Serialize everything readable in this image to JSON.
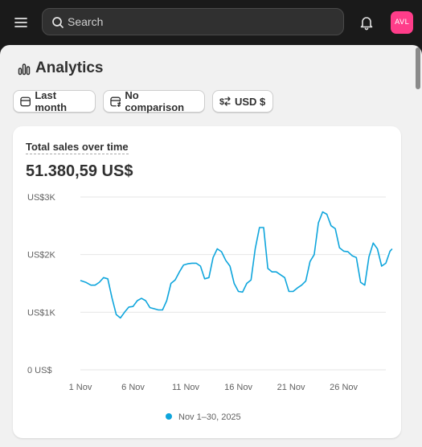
{
  "header": {
    "search_placeholder": "Search",
    "avatar_initials": "AVL",
    "avatar_color": "#ff3d8a"
  },
  "page": {
    "title": "Analytics"
  },
  "filters": {
    "date_range": "Last month",
    "comparison": "No comparison",
    "currency": "USD $"
  },
  "card": {
    "title": "Total sales over time",
    "total": "51.380,59 US$"
  },
  "chart_data": {
    "type": "line",
    "title": "Total sales over time",
    "y_tick_labels": [
      "0 US$",
      "US$1K",
      "US$2K",
      "US$3K"
    ],
    "y_ticks": [
      0,
      1000,
      2000,
      3000
    ],
    "ylim": [
      0,
      3000
    ],
    "x_tick_labels": [
      "1 Nov",
      "6 Nov",
      "11 Nov",
      "16 Nov",
      "21 Nov",
      "26 Nov"
    ],
    "x_tick_days": [
      1,
      6,
      11,
      16,
      21,
      26
    ],
    "xlim": [
      1,
      30
    ],
    "grid": true,
    "legend_position": "bottom",
    "series": [
      {
        "name": "Nov 1–30, 2025",
        "color": "#0ea5dc",
        "points": [
          [
            1,
            1550
          ],
          [
            1.5,
            1520
          ],
          [
            2,
            1470
          ],
          [
            2.4,
            1470
          ],
          [
            2.8,
            1520
          ],
          [
            3.2,
            1600
          ],
          [
            3.6,
            1580
          ],
          [
            4,
            1250
          ],
          [
            4.4,
            960
          ],
          [
            4.8,
            900
          ],
          [
            5.2,
            1000
          ],
          [
            5.6,
            1090
          ],
          [
            6,
            1100
          ],
          [
            6.4,
            1200
          ],
          [
            6.8,
            1240
          ],
          [
            7.2,
            1200
          ],
          [
            7.6,
            1080
          ],
          [
            8,
            1060
          ],
          [
            8.4,
            1040
          ],
          [
            8.8,
            1040
          ],
          [
            9.2,
            1200
          ],
          [
            9.6,
            1500
          ],
          [
            10,
            1560
          ],
          [
            10.4,
            1700
          ],
          [
            10.8,
            1820
          ],
          [
            11.2,
            1840
          ],
          [
            11.6,
            1850
          ],
          [
            12,
            1850
          ],
          [
            12.4,
            1800
          ],
          [
            12.8,
            1580
          ],
          [
            13.2,
            1600
          ],
          [
            13.6,
            1950
          ],
          [
            14,
            2100
          ],
          [
            14.4,
            2050
          ],
          [
            14.8,
            1900
          ],
          [
            15.2,
            1800
          ],
          [
            15.6,
            1500
          ],
          [
            16,
            1360
          ],
          [
            16.4,
            1350
          ],
          [
            16.8,
            1500
          ],
          [
            17.2,
            1560
          ],
          [
            17.6,
            2100
          ],
          [
            18,
            2470
          ],
          [
            18.4,
            2470
          ],
          [
            18.8,
            1760
          ],
          [
            19.2,
            1700
          ],
          [
            19.6,
            1700
          ],
          [
            20,
            1650
          ],
          [
            20.4,
            1600
          ],
          [
            20.8,
            1360
          ],
          [
            21.2,
            1360
          ],
          [
            21.6,
            1420
          ],
          [
            22,
            1470
          ],
          [
            22.4,
            1540
          ],
          [
            22.8,
            1880
          ],
          [
            23.2,
            2000
          ],
          [
            23.6,
            2550
          ],
          [
            24,
            2740
          ],
          [
            24.4,
            2700
          ],
          [
            24.8,
            2500
          ],
          [
            25.2,
            2450
          ],
          [
            25.6,
            2120
          ],
          [
            26,
            2060
          ],
          [
            26.4,
            2050
          ],
          [
            26.8,
            1980
          ],
          [
            27.2,
            1950
          ],
          [
            27.6,
            1520
          ],
          [
            28,
            1470
          ],
          [
            28.4,
            1960
          ],
          [
            28.8,
            2200
          ],
          [
            29.2,
            2100
          ],
          [
            29.6,
            1800
          ],
          [
            30,
            1850
          ],
          [
            30.4,
            2060
          ],
          [
            30.6,
            2100
          ]
        ]
      }
    ]
  }
}
